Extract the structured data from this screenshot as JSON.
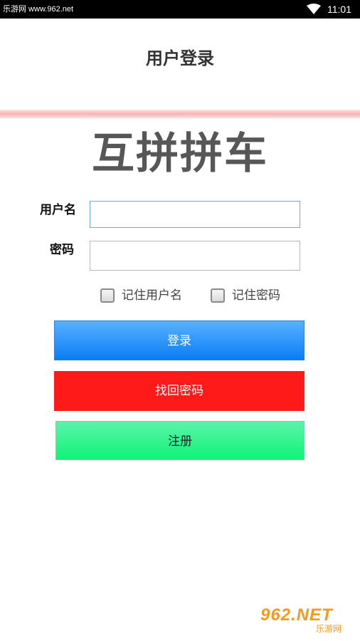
{
  "status_bar": {
    "source": "乐游网 www.962.net",
    "time": "11:01"
  },
  "header": {
    "title": "用户登录"
  },
  "logo": {
    "text": "互拼拼车"
  },
  "form": {
    "username_label": "用户名",
    "username_value": "",
    "password_label": "密码",
    "password_value": "",
    "remember_username_label": "记住用户名",
    "remember_username_checked": false,
    "remember_password_label": "记住密码",
    "remember_password_checked": false
  },
  "buttons": {
    "login": "登录",
    "recover": "找回密码",
    "register": "注册"
  },
  "watermark": {
    "main": "962.NET",
    "sub": "乐游网"
  },
  "colors": {
    "login": "#0a7df5",
    "recover": "#ff1a1a",
    "register": "#0ef578"
  }
}
